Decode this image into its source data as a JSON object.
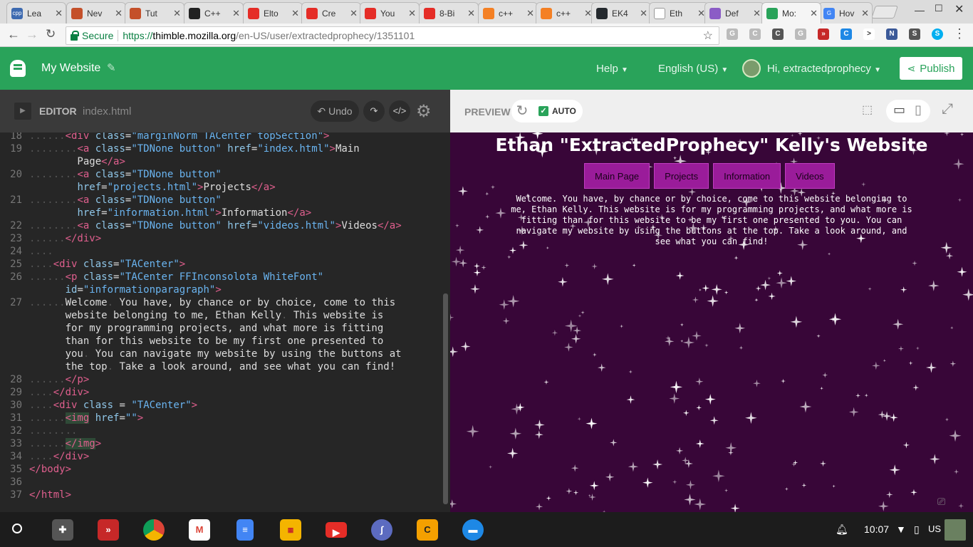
{
  "tabs": [
    {
      "title": "Lea",
      "fav": "#3d6ab0",
      "favtext": "cpp"
    },
    {
      "title": "Nev",
      "fav": "#c4502a",
      "favtext": ""
    },
    {
      "title": "Tut",
      "fav": "#c4502a",
      "favtext": ""
    },
    {
      "title": "C++",
      "fav": "#222222",
      "favtext": ""
    },
    {
      "title": "Elto",
      "fav": "#e52d27",
      "favtext": ""
    },
    {
      "title": "Cre",
      "fav": "#e52d27",
      "favtext": ""
    },
    {
      "title": "You",
      "fav": "#e52d27",
      "favtext": ""
    },
    {
      "title": "8-Bi",
      "fav": "#e52d27",
      "favtext": ""
    },
    {
      "title": "c++",
      "fav": "#f48024",
      "favtext": ""
    },
    {
      "title": "c++",
      "fav": "#f48024",
      "favtext": ""
    },
    {
      "title": "EK4",
      "fav": "#24292e",
      "favtext": ""
    },
    {
      "title": "Eth",
      "fav": "#ffffff",
      "favtext": ""
    },
    {
      "title": "Def",
      "fav": "#8b5cc6",
      "favtext": ""
    },
    {
      "title": "Mo:",
      "fav": "#29a35a",
      "favtext": ""
    },
    {
      "title": "Hov",
      "fav": "#4285f4",
      "favtext": "G"
    }
  ],
  "address": {
    "secure_label": "Secure",
    "https": "https://",
    "host": "thimble.mozilla.org",
    "path": "/en-US/user/extractedprophecy/1351101"
  },
  "thimble": {
    "project_name": "My Website",
    "help": "Help",
    "language": "English (US)",
    "greeting": "Hi, extractedprophecy",
    "publish": "Publish"
  },
  "editor": {
    "label": "EDITOR",
    "filename": "index.html",
    "undo": "Undo",
    "lines": [
      {
        "n": "18",
        "t": "......<div class=\"marginNorm TACenter topSection\">"
      },
      {
        "n": "19",
        "t": "........<a class=\"TDNone button\" href=\"index.html\">Main"
      },
      {
        "n": "",
        "t": "        Page</a>"
      },
      {
        "n": "20",
        "t": "........<a class=\"TDNone button\""
      },
      {
        "n": "",
        "t": "        href=\"projects.html\">Projects</a>"
      },
      {
        "n": "21",
        "t": "........<a class=\"TDNone button\""
      },
      {
        "n": "",
        "t": "        href=\"information.html\">Information</a>"
      },
      {
        "n": "22",
        "t": "........<a class=\"TDNone button\" href=\"videos.html\">Videos</a>"
      },
      {
        "n": "23",
        "t": "......</div>"
      },
      {
        "n": "24",
        "t": "...."
      },
      {
        "n": "25",
        "t": "....<div class=\"TACenter\">"
      },
      {
        "n": "26",
        "t": "......<p class=\"TACenter FFInconsolota WhiteFont\""
      },
      {
        "n": "",
        "t": "      id=\"informationparagraph\">"
      },
      {
        "n": "27",
        "t": "......Welcome. You have, by chance or by choice, come to this"
      },
      {
        "n": "",
        "t": "      website belonging to me, Ethan Kelly. This website is"
      },
      {
        "n": "",
        "t": "      for my programming projects, and what more is fitting"
      },
      {
        "n": "",
        "t": "      than for this website to be my first one presented to"
      },
      {
        "n": "",
        "t": "      you. You can navigate my website by using the buttons at"
      },
      {
        "n": "",
        "t": "      the top. Take a look around, and see what you can find!"
      },
      {
        "n": "28",
        "t": "......</p>"
      },
      {
        "n": "29",
        "t": "....</div>"
      },
      {
        "n": "30",
        "t": "....<div class = \"TACenter\">"
      },
      {
        "n": "31",
        "t": "......<img href=\"\">"
      },
      {
        "n": "32",
        "t": "........"
      },
      {
        "n": "33",
        "t": "......</img>"
      },
      {
        "n": "34",
        "t": "....</div>"
      },
      {
        "n": "35",
        "t": "</body>"
      },
      {
        "n": "36",
        "t": ""
      },
      {
        "n": "37",
        "t": "</html>"
      }
    ]
  },
  "preview": {
    "label": "PREVIEW",
    "auto": "AUTO",
    "site_title": "Ethan \"ExtractedProphecy\" Kelly's Website",
    "buttons": [
      "Main Page",
      "Projects",
      "Information",
      "Videos"
    ],
    "paragraph": "Welcome. You have, by chance or by choice, come to this website belonging to me, Ethan Kelly. This website is for my programming projects, and what more is fitting than for this website to be my first one presented to you. You can navigate my website by using the buttons at the top. Take a look around, and see what you can find!"
  },
  "shelf": {
    "time": "10:07",
    "locale": "US"
  },
  "colors": {
    "thimble_green": "#29a35a",
    "preview_bg": "#380638",
    "button_purple": "#9a1c9a"
  }
}
